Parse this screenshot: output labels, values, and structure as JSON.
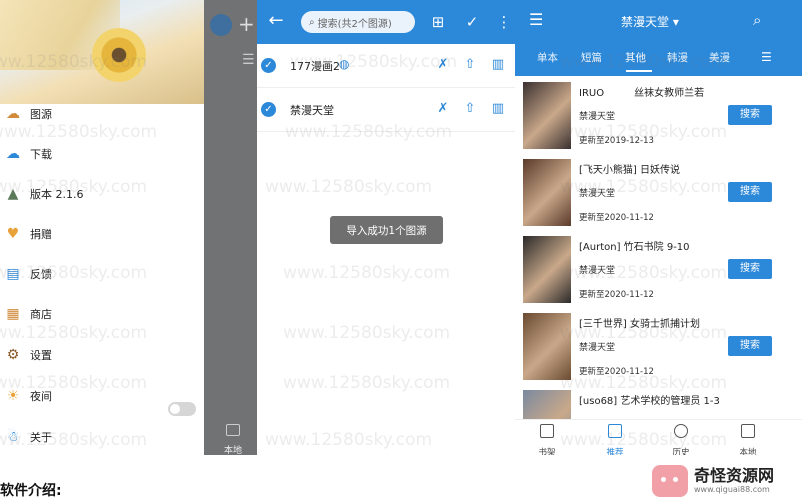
{
  "watermark": "www.12580sky.com",
  "panel1": {
    "menu": [
      {
        "label": "图源",
        "icon": "cloud-fish-icon",
        "color": "#d08a3a"
      },
      {
        "label": "下载",
        "icon": "cloud-download-icon",
        "color": "#2c88d9"
      },
      {
        "label": "版本 2.1.6",
        "icon": "rocket-icon",
        "color": "#5a7a5a"
      },
      {
        "label": "捐赠",
        "icon": "heart-icon",
        "color": "#e8a23a"
      },
      {
        "label": "反馈",
        "icon": "feedback-icon",
        "color": "#2c88d9"
      },
      {
        "label": "商店",
        "icon": "store-icon",
        "color": "#d08a3a"
      },
      {
        "label": "设置",
        "icon": "gear-icon",
        "color": "#8a5a2a"
      },
      {
        "label": "夜间",
        "icon": "sun-icon",
        "color": "#e8a23a"
      },
      {
        "label": "关于",
        "icon": "info-icon",
        "color": "#2c88d9"
      }
    ],
    "night_toggle_on": false,
    "overlay_local_label": "本地"
  },
  "panel2": {
    "search_placeholder": "搜索(共2个图源)",
    "sources": [
      {
        "name": "177漫画2"
      },
      {
        "name": "禁漫天堂"
      }
    ],
    "toast": "导入成功1个图源"
  },
  "panel3": {
    "title": "禁漫天堂",
    "tabs": [
      "单本",
      "短篇",
      "其他",
      "韩漫",
      "美漫",
      "("
    ],
    "active_tab": 2,
    "items": [
      {
        "title": "IRUO　　　丝袜女教师兰若",
        "source": "禁漫天堂",
        "updated": "更新至2019-12-13",
        "button": "搜索"
      },
      {
        "title": "[飞天小熊猫] 日妖传说",
        "source": "禁漫天堂",
        "updated": "更新至2020-11-12",
        "button": "搜索"
      },
      {
        "title": "[Aurton] 竹石书院 9-10",
        "source": "禁漫天堂",
        "updated": "更新至2020-11-12",
        "button": "搜索"
      },
      {
        "title": "[三千世界] 女骑士抓捕计划",
        "source": "禁漫天堂",
        "updated": "更新至2020-11-12",
        "button": "搜索"
      },
      {
        "title": "[uso68] 艺术学校的管理员 1-3",
        "source": "",
        "updated": "",
        "button": ""
      }
    ],
    "bottom_nav": [
      "书架",
      "推荐",
      "历史",
      "本地"
    ],
    "bottom_active": 1
  },
  "footer": {
    "caption": "软件介绍:",
    "logo_name": "奇怪资源网",
    "logo_url": "www.qiguai88.com"
  }
}
